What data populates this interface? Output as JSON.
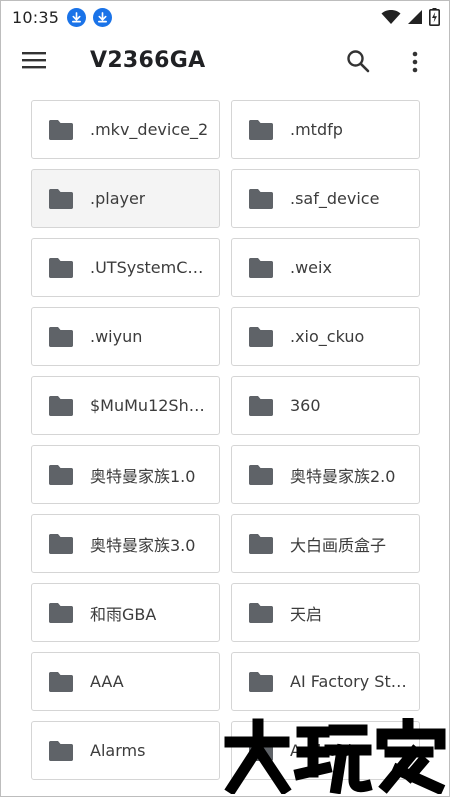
{
  "status_bar": {
    "time": "10:35",
    "notification_icons": [
      "download-icon",
      "download-icon"
    ],
    "system_icons": [
      "wifi-icon",
      "signal-icon",
      "battery-charging-icon"
    ]
  },
  "app_bar": {
    "title": "V2366GA",
    "icons": [
      "menu-icon",
      "search-icon",
      "more-vert-icon"
    ]
  },
  "folders": [
    {
      "name": ".mkv_device_2",
      "selected": false
    },
    {
      "name": ".mtdfp",
      "selected": false
    },
    {
      "name": ".player",
      "selected": true
    },
    {
      "name": ".saf_device",
      "selected": false
    },
    {
      "name": ".UTSystemC…",
      "selected": false
    },
    {
      "name": ".weix",
      "selected": false
    },
    {
      "name": ".wiyun",
      "selected": false
    },
    {
      "name": ".xio_ckuo",
      "selected": false
    },
    {
      "name": "$MuMu12Sh…",
      "selected": false
    },
    {
      "name": "360",
      "selected": false
    },
    {
      "name": "奥特曼家族1.0",
      "selected": false
    },
    {
      "name": "奥特曼家族2.0",
      "selected": false
    },
    {
      "name": "奥特曼家族3.0",
      "selected": false
    },
    {
      "name": "大白画质盒子",
      "selected": false
    },
    {
      "name": "和雨GBA",
      "selected": false
    },
    {
      "name": "天启",
      "selected": false
    },
    {
      "name": "AAA",
      "selected": false
    },
    {
      "name": "AI Factory St…",
      "selected": false
    },
    {
      "name": "Alarms",
      "selected": false
    },
    {
      "name": "Android",
      "selected": false
    }
  ],
  "watermark": {
    "text": "大玩家"
  },
  "colors": {
    "accent": "#1a73e8",
    "folder_icon": "#5f6368",
    "tile_border": "#d5d5d5",
    "selected_tile": "#f4f4f4"
  }
}
